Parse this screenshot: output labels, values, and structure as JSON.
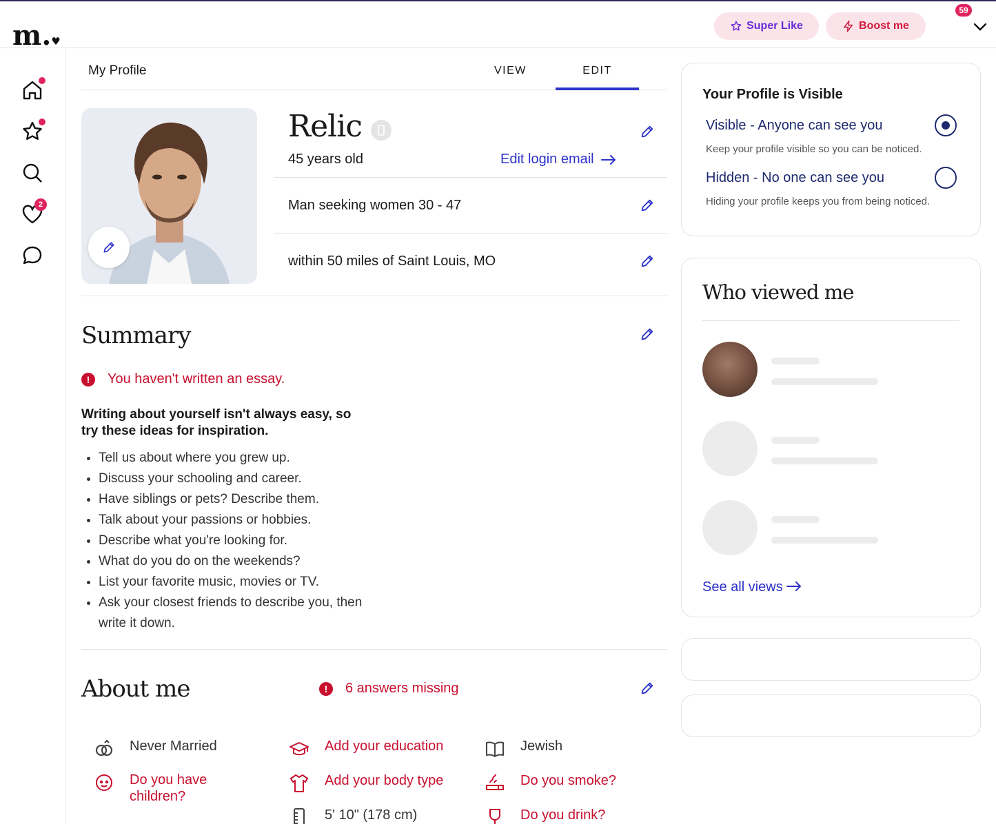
{
  "app": {
    "logo": "m.",
    "logo_heart": "♥"
  },
  "topbar": {
    "super_like": "Super Like",
    "boost_me": "Boost me",
    "notifications_count": "59",
    "account_menu_icon": "chevron-down-icon"
  },
  "sidenav": {
    "items": [
      {
        "icon": "home-icon",
        "has_dot": true
      },
      {
        "icon": "star-icon",
        "has_dot": true
      },
      {
        "icon": "search-icon",
        "has_dot": false
      },
      {
        "icon": "heart-icon",
        "badge": "2"
      },
      {
        "icon": "chat-icon",
        "has_dot": false
      }
    ]
  },
  "profile_header": {
    "title": "My Profile",
    "tabs": [
      {
        "label": "VIEW",
        "active": false
      },
      {
        "label": "EDIT",
        "active": true
      }
    ]
  },
  "profile": {
    "name": "Relic",
    "age": "45 years old",
    "edit_login_email": "Edit login email",
    "seeking": "Man seeking women 30 - 47",
    "location": "within 50 miles of Saint Louis, MO"
  },
  "summary": {
    "title": "Summary",
    "warning": "You haven't written an essay.",
    "hint": "Writing about yourself isn't always easy, so try these ideas for inspiration.",
    "tips": [
      "Tell us about where you grew up.",
      "Discuss your schooling and career.",
      "Have siblings or pets? Describe them.",
      "Talk about your passions or hobbies.",
      "Describe what you're looking for.",
      "What do you do on the weekends?",
      "List your favorite music, movies or TV.",
      "Ask your closest friends to describe you, then write it down."
    ]
  },
  "about": {
    "title": "About me",
    "missing": "6 answers missing",
    "items": [
      {
        "icon": "rings-icon",
        "label": "Never Married",
        "missing": false
      },
      {
        "icon": "graduation-cap-icon",
        "label": "Add your education",
        "missing": true
      },
      {
        "icon": "book-icon",
        "label": "Jewish",
        "missing": false
      },
      {
        "icon": "baby-face-icon",
        "label": "Do you have children?",
        "missing": true
      },
      {
        "icon": "shirt-icon",
        "label": "Add your body type",
        "missing": true
      },
      {
        "icon": "smoke-icon",
        "label": "Do you smoke?",
        "missing": true
      },
      {
        "icon": "ruler-icon",
        "label": "5' 10\" (178 cm)",
        "missing": false
      },
      {
        "icon": "wine-glass-icon",
        "label": "Do you drink?",
        "missing": true
      }
    ]
  },
  "visibility": {
    "title": "Your Profile is Visible",
    "options": [
      {
        "label": "Visible - Anyone can see you",
        "desc": "Keep your profile visible so you can be noticed.",
        "selected": true
      },
      {
        "label": "Hidden - No one can see you",
        "desc": "Hiding your profile keeps you from being noticed.",
        "selected": false
      }
    ]
  },
  "who_viewed": {
    "title": "Who viewed me",
    "see_all": "See all views"
  },
  "colors": {
    "accent": "#2d33c8",
    "alert": "#c8102e",
    "badge": "#e0245e",
    "navy": "#1e2a6e"
  }
}
